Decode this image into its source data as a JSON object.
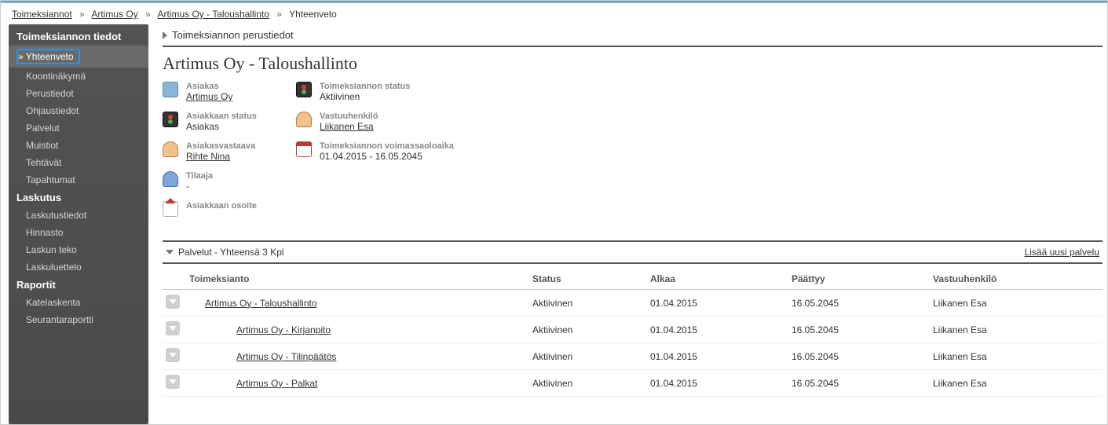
{
  "breadcrumb": {
    "items": [
      "Toimeksiannot",
      "Artimus Oy",
      "Artimus Oy - Taloushallinto"
    ],
    "current": "Yhteenveto"
  },
  "sidebar": {
    "sections": [
      {
        "title": "Toimeksiannon tiedot",
        "items": [
          "Yhteenveto",
          "Koontinäkymä",
          "Perustiedot",
          "Ohjaustiedot",
          "Palvelut",
          "Muistiot",
          "Tehtävät",
          "Tapahtumat"
        ],
        "activeIndex": 0
      },
      {
        "title": "Laskutus",
        "items": [
          "Laskutustiedot",
          "Hinnasto",
          "Laskun teko",
          "Laskuluettelo"
        ]
      },
      {
        "title": "Raportit",
        "items": [
          "Katelaskenta",
          "Seurantaraportti"
        ]
      }
    ]
  },
  "main": {
    "basicInfoHeader": "Toimeksiannon perustiedot",
    "pageTitle": "Artimus Oy - Taloushallinto",
    "info": {
      "customerLabel": "Asiakas",
      "customerValue": "Artimus Oy",
      "customerStatusLabel": "Asiakkaan status",
      "customerStatusValue": "Asiakas",
      "accountMgrLabel": "Asiakasvastaava",
      "accountMgrValue": "Rihte Nina",
      "ordererLabel": "Tilaaja",
      "ordererValue": "-",
      "addressLabel": "Asiakkaan osoite",
      "assignmentStatusLabel": "Toimeksiannon status",
      "assignmentStatusValue": "Aktiivinen",
      "responsibleLabel": "Vastuuhenkilö",
      "responsibleValue": "Liikanen Esa",
      "validityLabel": "Toimeksiannon voimassaoloaika",
      "validityValue": "01.04.2015 - 16.05.2045"
    },
    "servicesHeader": "Palvelut - Yhteensä 3 Kpl",
    "addLink": "Lisää uusi palvelu",
    "table": {
      "headers": {
        "name": "Toimeksianto",
        "status": "Status",
        "start": "Alkaa",
        "end": "Päättyy",
        "responsible": "Vastuuhenkilö"
      },
      "rows": [
        {
          "name": "Artimus Oy - Taloushallinto",
          "status": "Aktiivinen",
          "start": "01.04.2015",
          "end": "16.05.2045",
          "responsible": "Liikanen Esa",
          "indent": 1
        },
        {
          "name": "Artimus Oy - Kirjanpito",
          "status": "Aktiivinen",
          "start": "01.04.2015",
          "end": "16.05.2045",
          "responsible": "Liikanen Esa",
          "indent": 2
        },
        {
          "name": "Artimus Oy - Tilinpäätös",
          "status": "Aktiivinen",
          "start": "01.04.2015",
          "end": "16.05.2045",
          "responsible": "Liikanen Esa",
          "indent": 2
        },
        {
          "name": "Artimus Oy - Palkat",
          "status": "Aktiivinen",
          "start": "01.04.2015",
          "end": "16.05.2045",
          "responsible": "Liikanen Esa",
          "indent": 2
        }
      ]
    }
  }
}
